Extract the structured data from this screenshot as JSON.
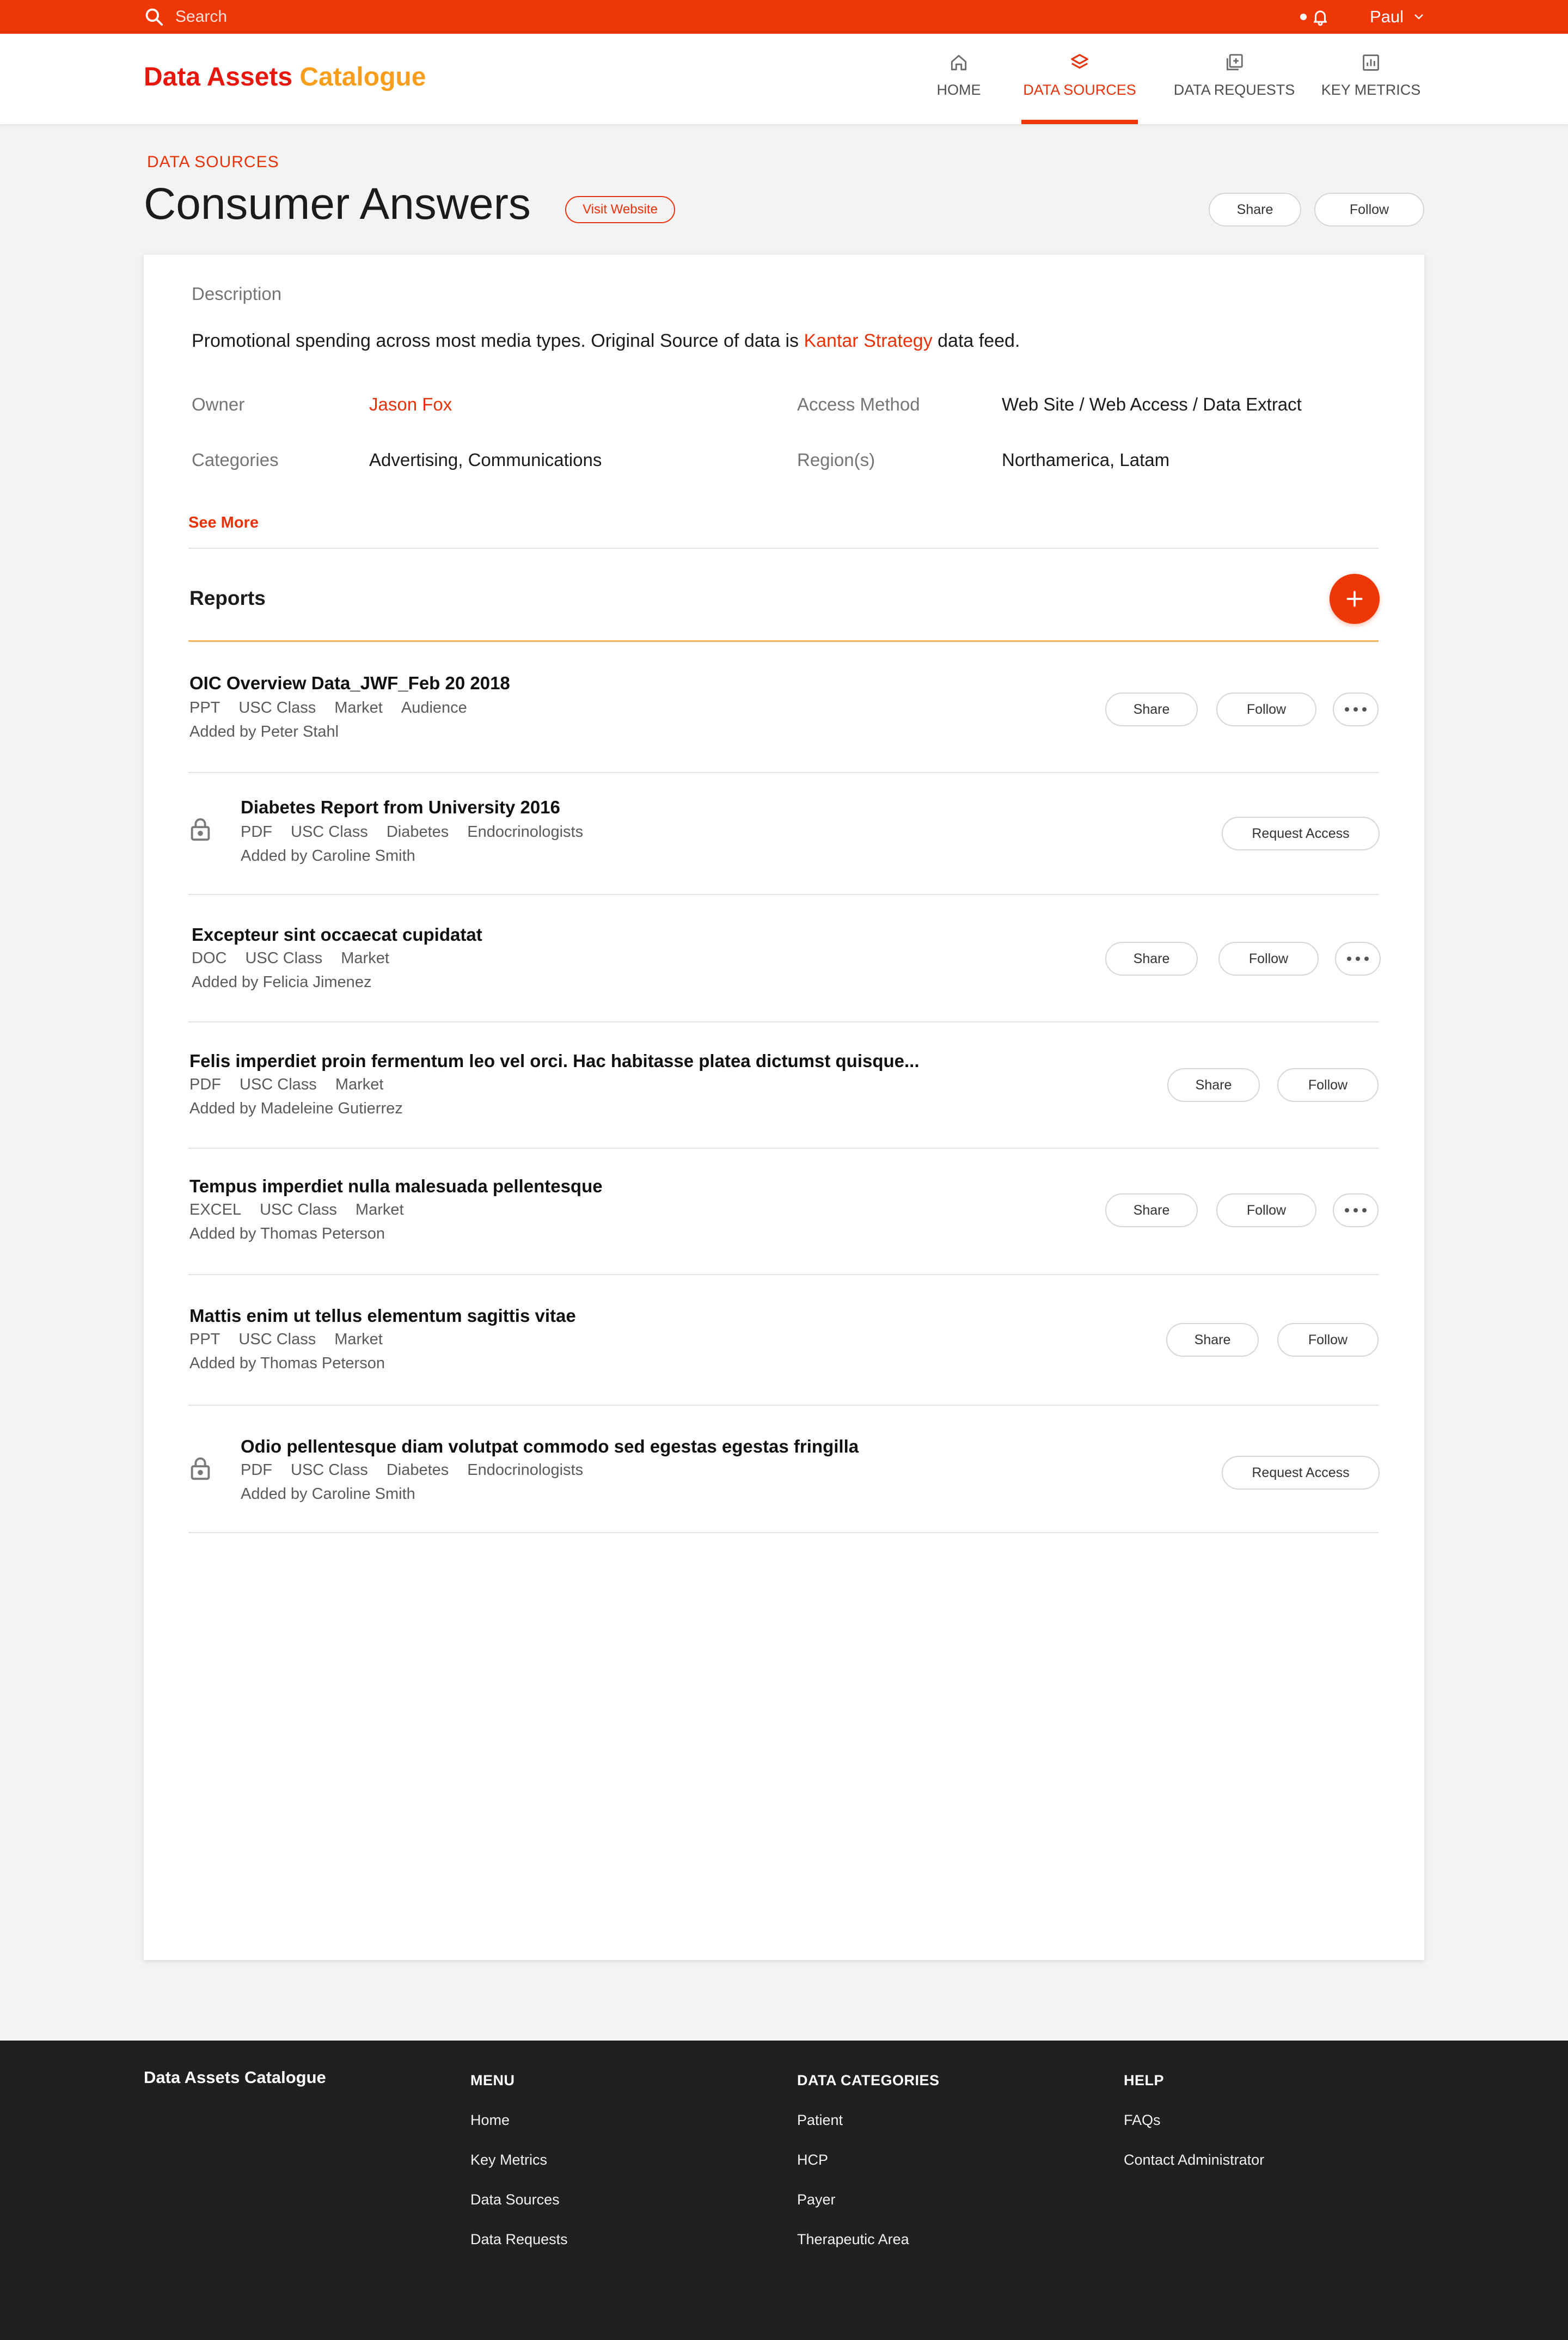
{
  "topbar": {
    "search_placeholder": "Search",
    "user_name": "Paul",
    "icons": {
      "search": "search-icon",
      "bell": "bell-icon",
      "user_menu": "chevron-down-icon"
    }
  },
  "header": {
    "logo_part1": "Data Assets",
    "logo_part2": "Catalogue",
    "colors": {
      "brand_red": "#e8170e",
      "brand_orange": "#f99d1c",
      "accent": "#ef3606"
    },
    "nav": [
      {
        "label": "HOME",
        "icon": "home-icon",
        "active": false
      },
      {
        "label": "DATA SOURCES",
        "icon": "layers-icon",
        "active": true
      },
      {
        "label": "DATA REQUESTS",
        "icon": "add-to-queue-icon",
        "active": false
      },
      {
        "label": "KEY METRICS",
        "icon": "bar-chart-icon",
        "active": false
      }
    ]
  },
  "page": {
    "breadcrumb": "DATA SOURCES",
    "title": "Consumer Answers",
    "visit_label": "Visit Website",
    "share_label": "Share",
    "follow_label": "Follow"
  },
  "details": {
    "description_label": "Description",
    "description_prefix": "Promotional spending across most media types. Original Source of data is ",
    "description_link": "Kantar Strategy",
    "description_suffix": " data feed.",
    "owner_label": "Owner",
    "owner_value": "Jason Fox",
    "categories_label": "Categories",
    "categories_value": "Advertising, Communications",
    "access_label": "Access Method",
    "access_value": "Web Site / Web Access / Data Extract",
    "region_label": "Region(s)",
    "region_value": "Northamerica, Latam",
    "see_more": "See More"
  },
  "reports": {
    "heading": "Reports",
    "items": [
      {
        "title": "OIC Overview Data_JWF_Feb 20 2018",
        "tags": [
          "PPT",
          "USC Class",
          "Market",
          "Audience"
        ],
        "added": "Added by Peter Stahl",
        "locked": false,
        "share": "Share",
        "follow": "Follow",
        "more": true
      },
      {
        "title": "Diabetes Report from University 2016",
        "tags": [
          "PDF",
          "USC Class",
          "Diabetes",
          "Endocrinologists"
        ],
        "added": "Added by Caroline Smith",
        "locked": true,
        "request": "Request Access"
      },
      {
        "title": "Excepteur sint occaecat cupidatat",
        "tags": [
          "DOC",
          "USC Class",
          "Market"
        ],
        "added": "Added by Felicia Jimenez",
        "locked": false,
        "share": "Share",
        "follow": "Follow",
        "more": true
      },
      {
        "title": "Felis imperdiet proin fermentum leo vel orci. Hac habitasse platea dictumst quisque...",
        "tags": [
          "PDF",
          "USC Class",
          "Market"
        ],
        "added": "Added by Madeleine Gutierrez",
        "locked": false,
        "share": "Share",
        "follow": "Follow",
        "more": false
      },
      {
        "title": "Tempus imperdiet nulla malesuada pellentesque",
        "tags": [
          "EXCEL",
          "USC Class",
          "Market"
        ],
        "added": "Added by Thomas Peterson",
        "locked": false,
        "share": "Share",
        "follow": "Follow",
        "more": true
      },
      {
        "title": "Mattis enim ut tellus elementum sagittis vitae",
        "tags": [
          "PPT",
          "USC Class",
          "Market"
        ],
        "added": "Added by Thomas Peterson",
        "locked": false,
        "share": "Share",
        "follow": "Follow",
        "more": false
      },
      {
        "title": "Odio pellentesque diam volutpat commodo sed egestas egestas fringilla",
        "tags": [
          "PDF",
          "USC Class",
          "Diabetes",
          "Endocrinologists"
        ],
        "added": "Added by Caroline Smith",
        "locked": true,
        "request": "Request Access"
      }
    ]
  },
  "footer": {
    "brand": "Data Assets Catalogue",
    "menu_heading": "MENU",
    "menu": [
      "Home",
      "Key Metrics",
      "Data Sources",
      "Data Requests"
    ],
    "categories_heading": "DATA CATEGORIES",
    "categories": [
      "Patient",
      "HCP",
      "Payer",
      "Therapeutic Area"
    ],
    "help_heading": "HELP",
    "help": [
      "FAQs",
      "Contact Administrator"
    ]
  }
}
